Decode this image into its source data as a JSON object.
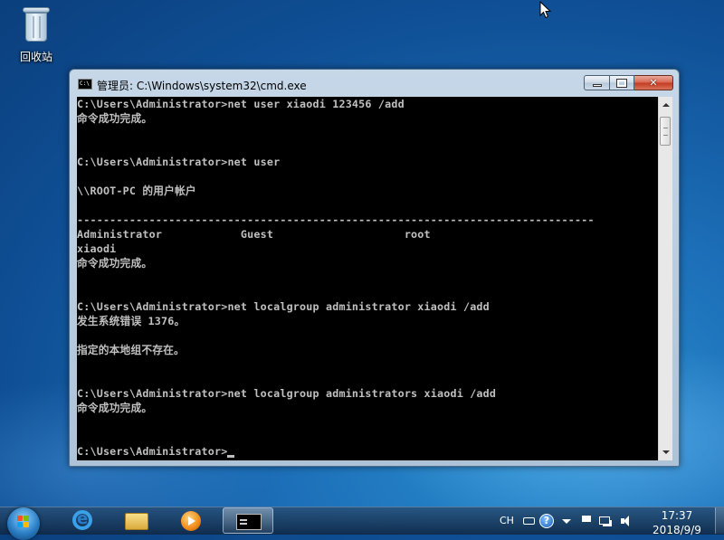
{
  "desktop": {
    "icons": [
      {
        "label": "回收站",
        "icon": "recycle-bin-icon"
      }
    ]
  },
  "window": {
    "title": "管理员: C:\\Windows\\system32\\cmd.exe",
    "icon": "cmd-icon",
    "buttons": {
      "minimize": "minimize-icon",
      "maximize": "maximize-icon",
      "close": "close-icon"
    }
  },
  "console": {
    "lines": [
      "C:\\Users\\Administrator>net user xiaodi 123456 /add",
      "命令成功完成。",
      "",
      "",
      "C:\\Users\\Administrator>net user",
      "",
      "\\\\ROOT-PC 的用户帐户",
      "",
      "-------------------------------------------------------------------------------",
      "Administrator            Guest                    root",
      "xiaodi",
      "命令成功完成。",
      "",
      "",
      "C:\\Users\\Administrator>net localgroup administrator xiaodi /add",
      "发生系统错误 1376。",
      "",
      "指定的本地组不存在。",
      "",
      "",
      "C:\\Users\\Administrator>net localgroup administrators xiaodi /add",
      "命令成功完成。",
      "",
      "",
      "C:\\Users\\Administrator>"
    ]
  },
  "taskbar": {
    "start_icon": "windows-start-icon",
    "pinned": [
      {
        "name": "internet-explorer",
        "icon": "ie-icon"
      },
      {
        "name": "windows-explorer",
        "icon": "folder-icon"
      },
      {
        "name": "media-player",
        "icon": "media-player-icon"
      },
      {
        "name": "command-prompt",
        "icon": "cmd-icon",
        "active": true
      }
    ],
    "tray": {
      "language": "CH",
      "clock_time": "17:37",
      "clock_date": "2018/9/9"
    }
  },
  "colors": {
    "console_bg": "#000000",
    "console_text": "#c0c0c0",
    "close_button": "#c4381f"
  }
}
